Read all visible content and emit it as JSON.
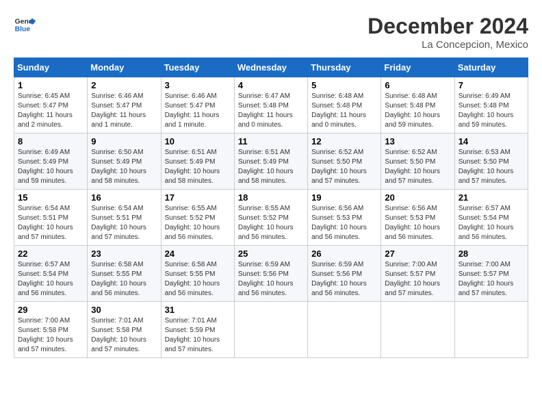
{
  "header": {
    "logo_line1": "General",
    "logo_line2": "Blue",
    "month_title": "December 2024",
    "location": "La Concepcion, Mexico"
  },
  "weekdays": [
    "Sunday",
    "Monday",
    "Tuesday",
    "Wednesday",
    "Thursday",
    "Friday",
    "Saturday"
  ],
  "weeks": [
    [
      {
        "day": "1",
        "info": "Sunrise: 6:45 AM\nSunset: 5:47 PM\nDaylight: 11 hours and 2 minutes."
      },
      {
        "day": "2",
        "info": "Sunrise: 6:46 AM\nSunset: 5:47 PM\nDaylight: 11 hours and 1 minute."
      },
      {
        "day": "3",
        "info": "Sunrise: 6:46 AM\nSunset: 5:47 PM\nDaylight: 11 hours and 1 minute."
      },
      {
        "day": "4",
        "info": "Sunrise: 6:47 AM\nSunset: 5:48 PM\nDaylight: 11 hours and 0 minutes."
      },
      {
        "day": "5",
        "info": "Sunrise: 6:48 AM\nSunset: 5:48 PM\nDaylight: 11 hours and 0 minutes."
      },
      {
        "day": "6",
        "info": "Sunrise: 6:48 AM\nSunset: 5:48 PM\nDaylight: 10 hours and 59 minutes."
      },
      {
        "day": "7",
        "info": "Sunrise: 6:49 AM\nSunset: 5:48 PM\nDaylight: 10 hours and 59 minutes."
      }
    ],
    [
      {
        "day": "8",
        "info": "Sunrise: 6:49 AM\nSunset: 5:49 PM\nDaylight: 10 hours and 59 minutes."
      },
      {
        "day": "9",
        "info": "Sunrise: 6:50 AM\nSunset: 5:49 PM\nDaylight: 10 hours and 58 minutes."
      },
      {
        "day": "10",
        "info": "Sunrise: 6:51 AM\nSunset: 5:49 PM\nDaylight: 10 hours and 58 minutes."
      },
      {
        "day": "11",
        "info": "Sunrise: 6:51 AM\nSunset: 5:49 PM\nDaylight: 10 hours and 58 minutes."
      },
      {
        "day": "12",
        "info": "Sunrise: 6:52 AM\nSunset: 5:50 PM\nDaylight: 10 hours and 57 minutes."
      },
      {
        "day": "13",
        "info": "Sunrise: 6:52 AM\nSunset: 5:50 PM\nDaylight: 10 hours and 57 minutes."
      },
      {
        "day": "14",
        "info": "Sunrise: 6:53 AM\nSunset: 5:50 PM\nDaylight: 10 hours and 57 minutes."
      }
    ],
    [
      {
        "day": "15",
        "info": "Sunrise: 6:54 AM\nSunset: 5:51 PM\nDaylight: 10 hours and 57 minutes."
      },
      {
        "day": "16",
        "info": "Sunrise: 6:54 AM\nSunset: 5:51 PM\nDaylight: 10 hours and 57 minutes."
      },
      {
        "day": "17",
        "info": "Sunrise: 6:55 AM\nSunset: 5:52 PM\nDaylight: 10 hours and 56 minutes."
      },
      {
        "day": "18",
        "info": "Sunrise: 6:55 AM\nSunset: 5:52 PM\nDaylight: 10 hours and 56 minutes."
      },
      {
        "day": "19",
        "info": "Sunrise: 6:56 AM\nSunset: 5:53 PM\nDaylight: 10 hours and 56 minutes."
      },
      {
        "day": "20",
        "info": "Sunrise: 6:56 AM\nSunset: 5:53 PM\nDaylight: 10 hours and 56 minutes."
      },
      {
        "day": "21",
        "info": "Sunrise: 6:57 AM\nSunset: 5:54 PM\nDaylight: 10 hours and 56 minutes."
      }
    ],
    [
      {
        "day": "22",
        "info": "Sunrise: 6:57 AM\nSunset: 5:54 PM\nDaylight: 10 hours and 56 minutes."
      },
      {
        "day": "23",
        "info": "Sunrise: 6:58 AM\nSunset: 5:55 PM\nDaylight: 10 hours and 56 minutes."
      },
      {
        "day": "24",
        "info": "Sunrise: 6:58 AM\nSunset: 5:55 PM\nDaylight: 10 hours and 56 minutes."
      },
      {
        "day": "25",
        "info": "Sunrise: 6:59 AM\nSunset: 5:56 PM\nDaylight: 10 hours and 56 minutes."
      },
      {
        "day": "26",
        "info": "Sunrise: 6:59 AM\nSunset: 5:56 PM\nDaylight: 10 hours and 56 minutes."
      },
      {
        "day": "27",
        "info": "Sunrise: 7:00 AM\nSunset: 5:57 PM\nDaylight: 10 hours and 57 minutes."
      },
      {
        "day": "28",
        "info": "Sunrise: 7:00 AM\nSunset: 5:57 PM\nDaylight: 10 hours and 57 minutes."
      }
    ],
    [
      {
        "day": "29",
        "info": "Sunrise: 7:00 AM\nSunset: 5:58 PM\nDaylight: 10 hours and 57 minutes."
      },
      {
        "day": "30",
        "info": "Sunrise: 7:01 AM\nSunset: 5:58 PM\nDaylight: 10 hours and 57 minutes."
      },
      {
        "day": "31",
        "info": "Sunrise: 7:01 AM\nSunset: 5:59 PM\nDaylight: 10 hours and 57 minutes."
      },
      null,
      null,
      null,
      null
    ]
  ]
}
